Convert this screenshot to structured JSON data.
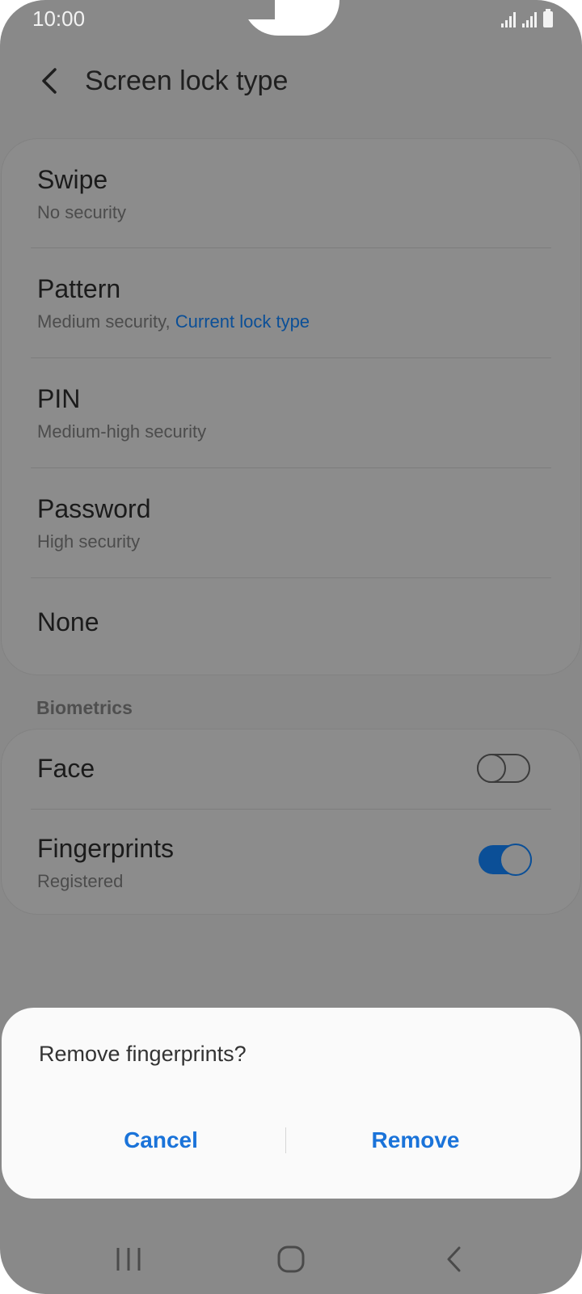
{
  "status_bar": {
    "time": "10:00"
  },
  "header": {
    "title": "Screen lock type"
  },
  "lock_types": [
    {
      "title": "Swipe",
      "subtitle": "No security",
      "subtitle_accent": ""
    },
    {
      "title": "Pattern",
      "subtitle": "Medium security, ",
      "subtitle_accent": "Current lock type"
    },
    {
      "title": "PIN",
      "subtitle": "Medium-high security",
      "subtitle_accent": ""
    },
    {
      "title": "Password",
      "subtitle": "High security",
      "subtitle_accent": ""
    },
    {
      "title": "None",
      "subtitle": "",
      "subtitle_accent": ""
    }
  ],
  "biometrics": {
    "section_label": "Biometrics",
    "items": [
      {
        "title": "Face",
        "subtitle": "",
        "enabled": false
      },
      {
        "title": "Fingerprints",
        "subtitle": "Registered",
        "enabled": true
      }
    ]
  },
  "dialog": {
    "title": "Remove fingerprints?",
    "cancel_label": "Cancel",
    "remove_label": "Remove"
  },
  "colors": {
    "accent": "#0b4f97",
    "dialog_button": "#1a73d9",
    "dim_background": "#898989"
  },
  "icons": {
    "back": "chevron-left-icon",
    "recent_apps": "recent-apps-icon",
    "home": "home-icon",
    "nav_back": "nav-back-icon"
  }
}
